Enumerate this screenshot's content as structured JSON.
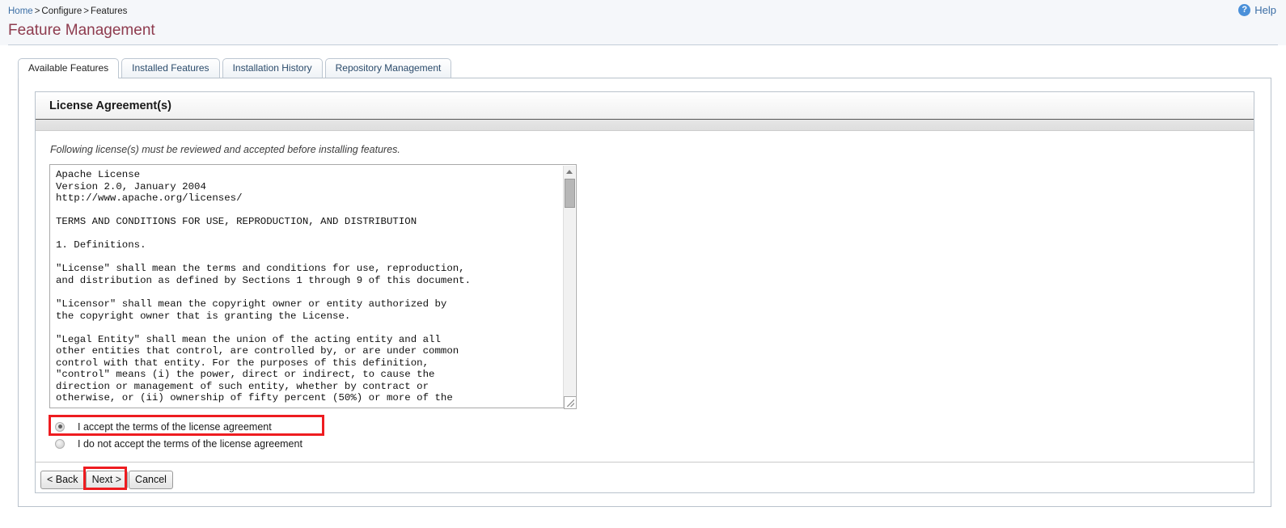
{
  "header": {
    "breadcrumb": [
      {
        "label": "Home",
        "link": true
      },
      {
        "label": "Configure",
        "link": false
      },
      {
        "label": "Features",
        "link": false
      }
    ],
    "separator": ">",
    "title": "Feature Management",
    "help_label": "Help",
    "help_icon": "help-circle-icon",
    "help_glyph": "?",
    "title_color": "#8e3b4e",
    "link_color": "#3b6ea5"
  },
  "tabs": [
    {
      "label": "Available Features",
      "active": true
    },
    {
      "label": "Installed Features",
      "active": false
    },
    {
      "label": "Installation History",
      "active": false
    },
    {
      "label": "Repository Management",
      "active": false
    }
  ],
  "panel": {
    "title": "License Agreement(s)",
    "intro": "Following license(s) must be reviewed and accepted before installing features."
  },
  "license": {
    "text": "Apache License\nVersion 2.0, January 2004\nhttp://www.apache.org/licenses/\n\nTERMS AND CONDITIONS FOR USE, REPRODUCTION, AND DISTRIBUTION\n\n1. Definitions.\n\n\"License\" shall mean the terms and conditions for use, reproduction,\nand distribution as defined by Sections 1 through 9 of this document.\n\n\"Licensor\" shall mean the copyright owner or entity authorized by\nthe copyright owner that is granting the License.\n\n\"Legal Entity\" shall mean the union of the acting entity and all\nother entities that control, are controlled by, or are under common\ncontrol with that entity. For the purposes of this definition,\n\"control\" means (i) the power, direct or indirect, to cause the\ndirection or management of such entity, whether by contract or\notherwise, or (ii) ownership of fifty percent (50%) or more of the",
    "scrollbar": {
      "up_icon": "scroll-up-arrow-icon",
      "down_icon": "scroll-down-arrow-icon",
      "thumb": "scroll-thumb",
      "resize_icon": "resize-grip-icon"
    }
  },
  "options": [
    {
      "label": "I accept the terms of the license agreement",
      "checked": true,
      "highlighted": true
    },
    {
      "label": "I do not accept the terms of the license agreement",
      "checked": false,
      "highlighted": false
    }
  ],
  "buttons": [
    {
      "label": "< Back",
      "highlighted": false
    },
    {
      "label": "Next >",
      "highlighted": true
    },
    {
      "label": "Cancel",
      "highlighted": false
    }
  ],
  "highlight_color": "#ee1c20"
}
